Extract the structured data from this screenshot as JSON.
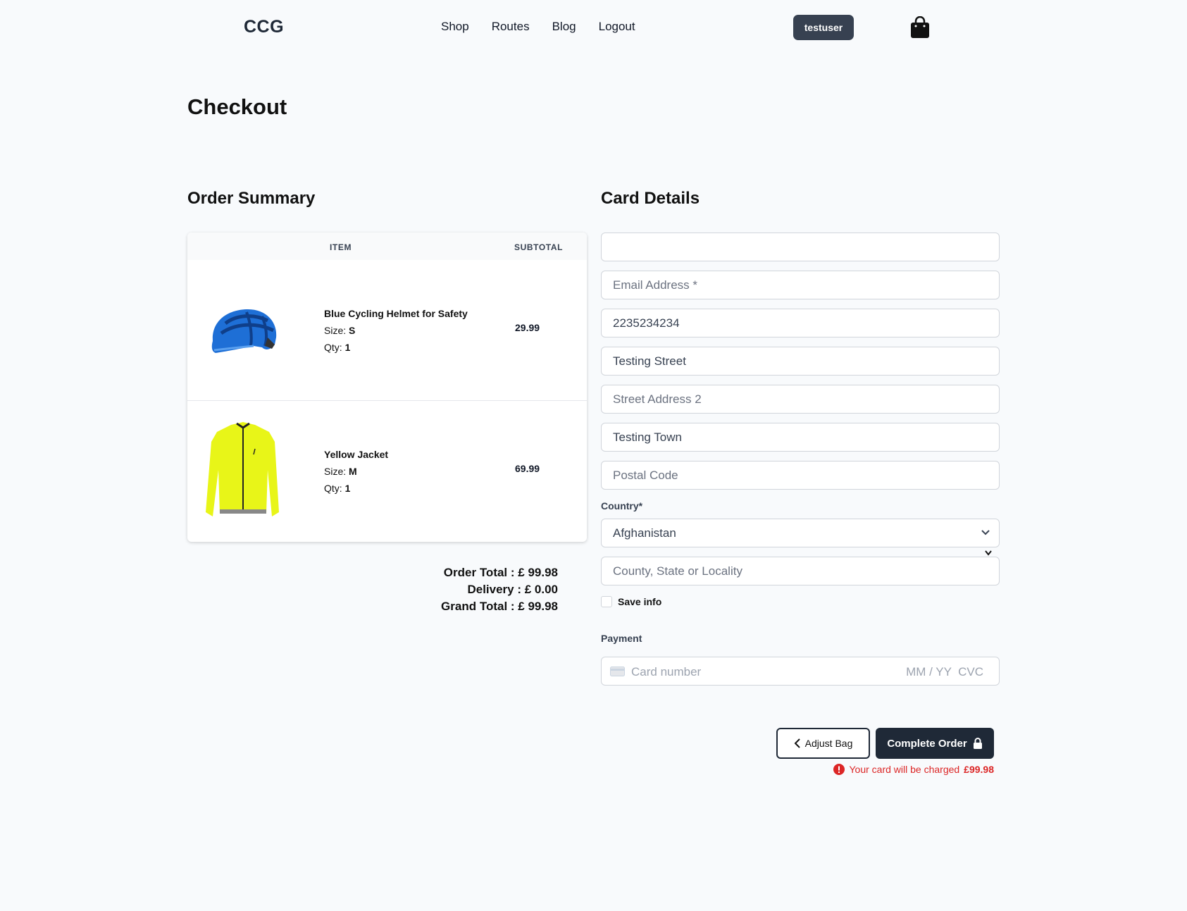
{
  "header": {
    "logo": "CCG",
    "nav": [
      "Shop",
      "Routes",
      "Blog",
      "Logout"
    ],
    "user": "testuser"
  },
  "page_title": "Checkout",
  "order_summary": {
    "title": "Order Summary",
    "columns": {
      "item": "ITEM",
      "subtotal": "SUBTOTAL"
    },
    "items": [
      {
        "name": "Blue Cycling Helmet for Safety",
        "size_label": "Size:",
        "size": "S",
        "qty_label": "Qty:",
        "qty": "1",
        "subtotal": "29.99",
        "color": "#1e6fd6"
      },
      {
        "name": "Yellow Jacket",
        "size_label": "Size:",
        "size": "M",
        "qty_label": "Qty:",
        "qty": "1",
        "subtotal": "69.99",
        "color": "#e8f518"
      }
    ],
    "order_total": "Order Total : £ 99.98",
    "delivery": "Delivery : £ 0.00",
    "grand_total": "Grand Total : £ 99.98"
  },
  "card_details": {
    "title": "Card Details",
    "fields": [
      {
        "value": "",
        "placeholder": ""
      },
      {
        "value": "",
        "placeholder": "Email Address *"
      },
      {
        "value": "2235234234",
        "placeholder": ""
      },
      {
        "value": "Testing Street",
        "placeholder": ""
      },
      {
        "value": "",
        "placeholder": "Street Address 2"
      },
      {
        "value": "Testing Town",
        "placeholder": ""
      },
      {
        "value": "",
        "placeholder": "Postal Code"
      }
    ],
    "country_label": "Country*",
    "country_value": "Afghanistan",
    "county_placeholder": "County, State or Locality",
    "save_info": "Save info",
    "payment_label": "Payment",
    "card_number_placeholder": "Card number",
    "card_exp_cvc": "MM / YY  CVC"
  },
  "actions": {
    "adjust_bag": "Adjust Bag",
    "complete_order": "Complete Order",
    "charge_text": "Your card will be charged",
    "charge_amount": "£99.98"
  },
  "colors": {
    "primary": "#1f2937",
    "badge": "#374151",
    "error": "#dc2626",
    "background": "#f8fafc"
  }
}
